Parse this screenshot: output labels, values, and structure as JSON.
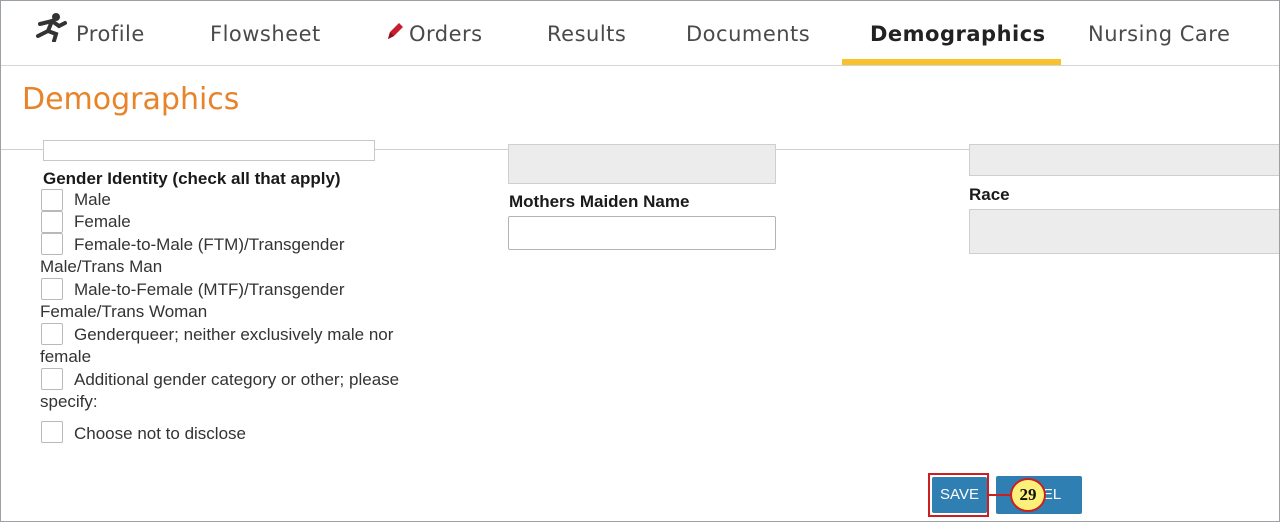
{
  "tabs": [
    {
      "label": "Profile",
      "icon": "running-person-icon"
    },
    {
      "label": "Flowsheet"
    },
    {
      "label": "Orders",
      "icon": "pencil-icon"
    },
    {
      "label": "Results"
    },
    {
      "label": "Documents"
    },
    {
      "label": "Demographics",
      "active": true
    },
    {
      "label": "Nursing Care"
    }
  ],
  "header": {
    "title": "Demographics"
  },
  "form": {
    "gender_identity_label": "Gender Identity (check all that apply)",
    "gender_options": [
      "Male",
      "Female",
      "Female-to-Male (FTM)/Transgender",
      "Male/Trans Man",
      "Male-to-Female (MTF)/Transgender",
      "Female/Trans Woman",
      "Genderqueer; neither exclusively male nor",
      "female",
      "Additional gender category or other; please",
      "specify:",
      "Choose not to disclose"
    ],
    "mothers_maiden_name_label": "Mothers Maiden Name",
    "mothers_maiden_name_value": "",
    "race_label": "Race"
  },
  "actions": {
    "save_label": "SAVE",
    "cancel_label": "EL"
  },
  "callout": {
    "number": "29"
  },
  "colors": {
    "accent": "#e8832a",
    "tab_underline": "#f7c22d",
    "button": "#2f7fb3",
    "callout_border": "#cc1f1f",
    "callout_fill": "#fdf07a"
  }
}
